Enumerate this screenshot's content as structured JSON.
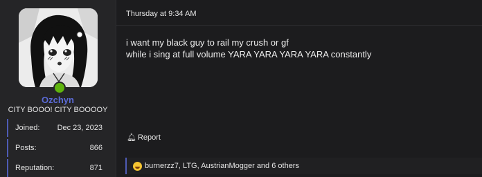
{
  "user": {
    "name": "Ozchyn",
    "title": "CITY BOOO! CITY BOOOOY",
    "stats": [
      {
        "label": "Joined:",
        "value": "Dec 23, 2023"
      },
      {
        "label": "Posts:",
        "value": "866"
      },
      {
        "label": "Reputation:",
        "value": "871"
      }
    ],
    "online_color": "#5fb40e"
  },
  "post": {
    "date": "Thursday at 9:34 AM",
    "lines": [
      "i want my black guy to rail my crush or gf",
      "while i sing at full volume YARA YARA YARA YARA constantly"
    ],
    "report_label": "Report",
    "reactions": {
      "emoji": "laughing-face-icon",
      "names": "burnerzz7, LTG, AustrianMogger and 6 others"
    }
  },
  "colors": {
    "accent": "#4e5bb5",
    "username": "#5b6bd8",
    "background": "#1c1c1e",
    "sidebar": "#252527"
  }
}
